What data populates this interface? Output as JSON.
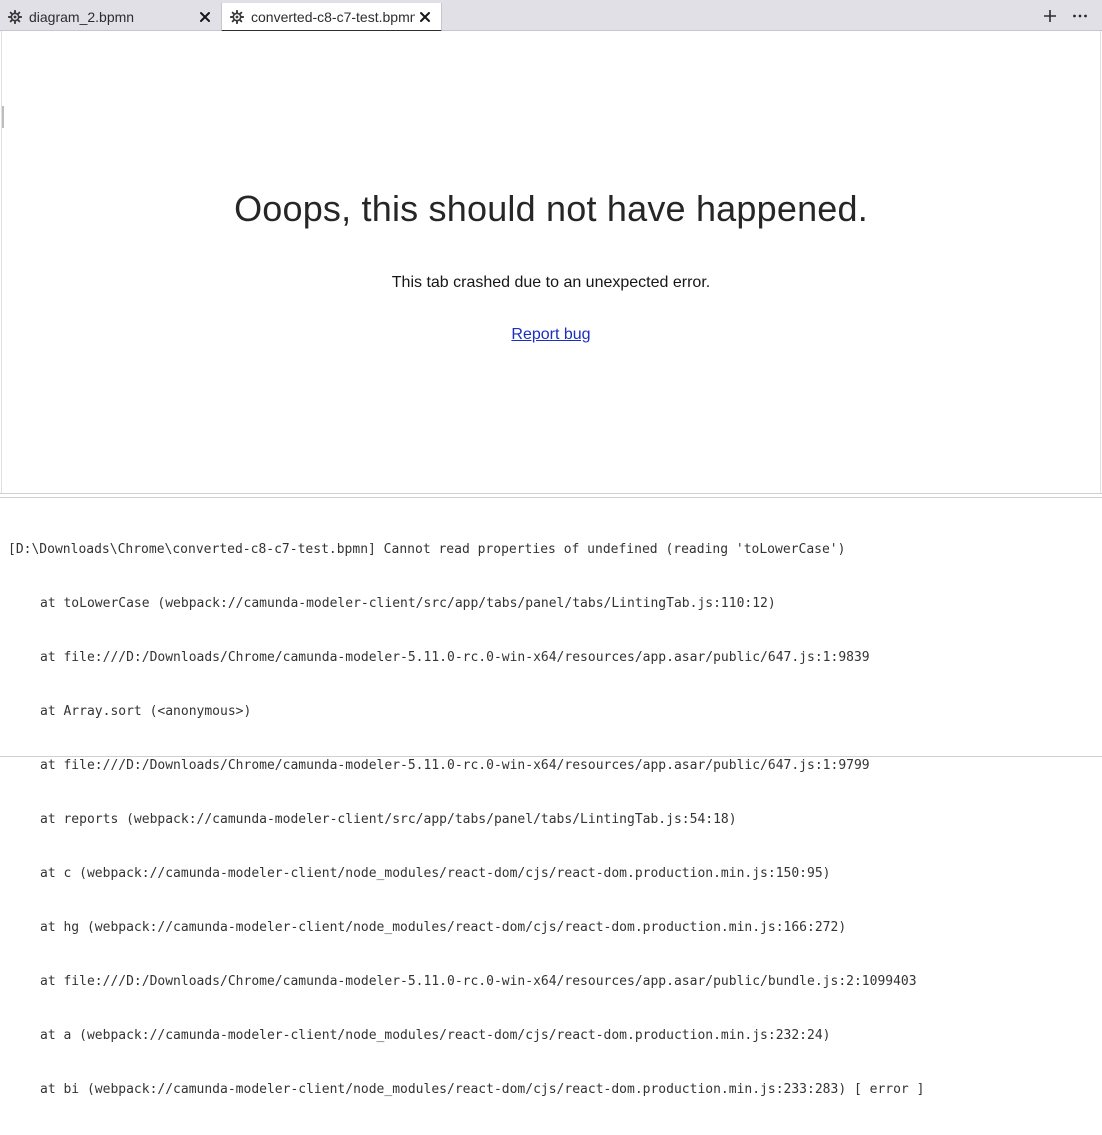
{
  "tabs": [
    {
      "label": "diagram_2.bpmn",
      "icon": "gear-icon",
      "active": false
    },
    {
      "label": "converted-c8-c7-test.bpmn",
      "icon": "gear-icon",
      "active": true
    }
  ],
  "tab_actions": {
    "add_icon": "plus-icon",
    "more_icon": "more-horizontal-icon"
  },
  "crash": {
    "title": "Ooops, this should not have happened.",
    "message": "This tab crashed due to an unexpected error.",
    "report_link": "Report bug"
  },
  "log": {
    "lines": [
      "[D:\\Downloads\\Chrome\\converted-c8-c7-test.bpmn] Cannot read properties of undefined (reading 'toLowerCase')",
      "at toLowerCase (webpack://camunda-modeler-client/src/app/tabs/panel/tabs/LintingTab.js:110:12)",
      "at file:///D:/Downloads/Chrome/camunda-modeler-5.11.0-rc.0-win-x64/resources/app.asar/public/647.js:1:9839",
      "at Array.sort (<anonymous>)",
      "at file:///D:/Downloads/Chrome/camunda-modeler-5.11.0-rc.0-win-x64/resources/app.asar/public/647.js:1:9799",
      "at reports (webpack://camunda-modeler-client/src/app/tabs/panel/tabs/LintingTab.js:54:18)",
      "at c (webpack://camunda-modeler-client/node_modules/react-dom/cjs/react-dom.production.min.js:150:95)",
      "at hg (webpack://camunda-modeler-client/node_modules/react-dom/cjs/react-dom.production.min.js:166:272)",
      "at file:///D:/Downloads/Chrome/camunda-modeler-5.11.0-rc.0-win-x64/resources/app.asar/public/bundle.js:2:1099403",
      "at a (webpack://camunda-modeler-client/node_modules/react-dom/cjs/react-dom.production.min.js:232:24)",
      "at bi (webpack://camunda-modeler-client/node_modules/react-dom/cjs/react-dom.production.min.js:233:283) [ error ]"
    ]
  }
}
